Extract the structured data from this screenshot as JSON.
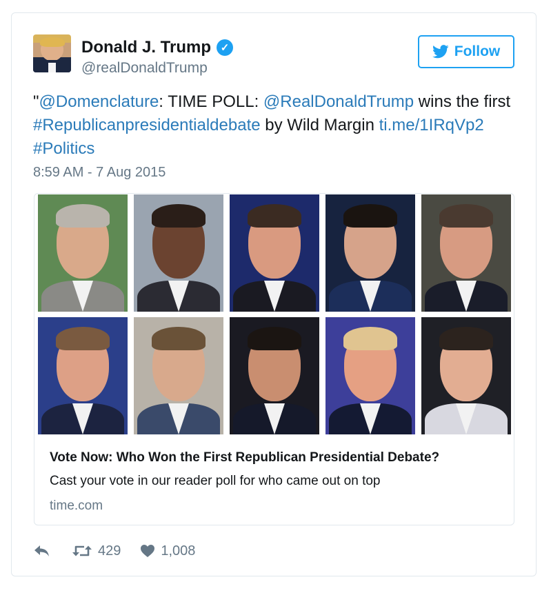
{
  "user": {
    "name": "Donald J. Trump",
    "handle": "@realDonaldTrump",
    "verified_glyph": "✓"
  },
  "follow_button": {
    "label": "Follow",
    "icon": "twitter-bird-icon"
  },
  "tweet": {
    "segments": [
      {
        "text": "\"",
        "type": "text"
      },
      {
        "text": "@Domenclature",
        "type": "link"
      },
      {
        "text": ": TIME POLL: ",
        "type": "text"
      },
      {
        "text": "@RealDonaldTrump",
        "type": "link"
      },
      {
        "text": " wins the first ",
        "type": "text"
      },
      {
        "text": "#Republicanpresidentialdebate",
        "type": "link"
      },
      {
        "text": " by Wild Margin ",
        "type": "text"
      },
      {
        "text": "ti.me/1IRqVp2",
        "type": "link"
      },
      {
        "text": " ",
        "type": "text"
      },
      {
        "text": "#Politics",
        "type": "link"
      }
    ],
    "timestamp": "8:59 AM - 7 Aug 2015"
  },
  "card": {
    "title": "Vote Now: Who Won the First Republican Presidential Debate?",
    "description": "Cast your vote in our reader poll for who came out on top",
    "domain": "time.com"
  },
  "actions": {
    "reply_icon": "reply-icon",
    "retweet_icon": "retweet-icon",
    "retweet_count": "429",
    "like_icon": "heart-icon",
    "like_count": "1,008"
  },
  "colors": {
    "link": "#2b7bb9",
    "accent": "#1da1f2",
    "muted": "#657786",
    "border": "#e1e8ed"
  },
  "portraits": [
    {
      "bg": "#5f8a54",
      "skin": "#d9a98a",
      "hair": "#b9b4ac",
      "suit": "#8a8a86"
    },
    {
      "bg": "#9aa4b0",
      "skin": "#6b4330",
      "hair": "#2a1e18",
      "suit": "#2b2b33"
    },
    {
      "bg": "#1d2a6b",
      "skin": "#d99a80",
      "hair": "#3b2b22",
      "suit": "#1a1a22"
    },
    {
      "bg": "#17233f",
      "skin": "#d6a38a",
      "hair": "#1a1410",
      "suit": "#1c2e5a"
    },
    {
      "bg": "#4a4a42",
      "skin": "#d79b82",
      "hair": "#4a3a30",
      "suit": "#1a1d2a"
    },
    {
      "bg": "#2b3f8a",
      "skin": "#dda086",
      "hair": "#7a5a40",
      "suit": "#1c2340"
    },
    {
      "bg": "#b8b2a8",
      "skin": "#d8a98c",
      "hair": "#6a5238",
      "suit": "#3a4a6a"
    },
    {
      "bg": "#1a1a22",
      "skin": "#c98e70",
      "hair": "#1b1512",
      "suit": "#15192a"
    },
    {
      "bg": "#3d3f9a",
      "skin": "#e5a083",
      "hair": "#e0c490",
      "suit": "#141a33"
    },
    {
      "bg": "#1f2026",
      "skin": "#e2ad92",
      "hair": "#2c231e",
      "suit": "#d8d8e0"
    }
  ]
}
